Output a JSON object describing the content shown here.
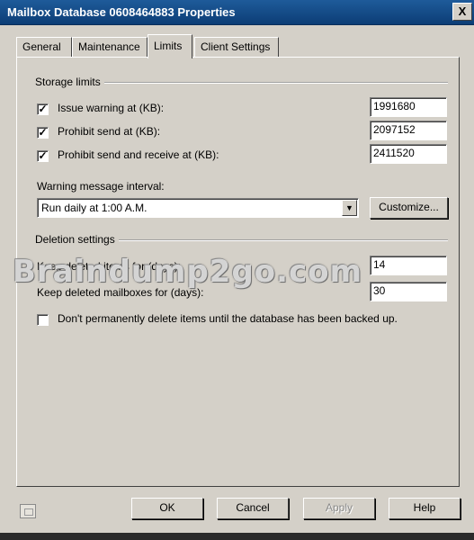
{
  "window": {
    "title": "Mailbox Database 0608464883 Properties",
    "close_glyph": "X"
  },
  "tabs": [
    {
      "label": "General"
    },
    {
      "label": "Maintenance"
    },
    {
      "label": "Limits"
    },
    {
      "label": "Client Settings"
    }
  ],
  "storage": {
    "group_label": "Storage limits",
    "issue_warning": {
      "label": "Issue warning at (KB):",
      "checked": true,
      "value": "1991680"
    },
    "prohibit_send": {
      "label": "Prohibit send at (KB):",
      "checked": true,
      "value": "2097152"
    },
    "prohibit_send_receive": {
      "label": "Prohibit send and receive at (KB):",
      "checked": true,
      "value": "2411520"
    }
  },
  "warning_interval": {
    "label": "Warning message interval:",
    "selected": "Run daily at 1:00 A.M.",
    "customize_label": "Customize..."
  },
  "deletion": {
    "group_label": "Deletion settings",
    "keep_deleted_items": {
      "label": "Keep deleted items for (days):",
      "value": "14"
    },
    "keep_deleted_mailboxes": {
      "label": "Keep deleted mailboxes for (days):",
      "value": "30"
    },
    "dont_delete_until_backup": {
      "label": "Don't permanently delete items until the database has been backed up.",
      "checked": false
    }
  },
  "buttons": {
    "ok": "OK",
    "cancel": "Cancel",
    "apply": "Apply",
    "help": "Help"
  },
  "watermark": "Braindump2go.com"
}
